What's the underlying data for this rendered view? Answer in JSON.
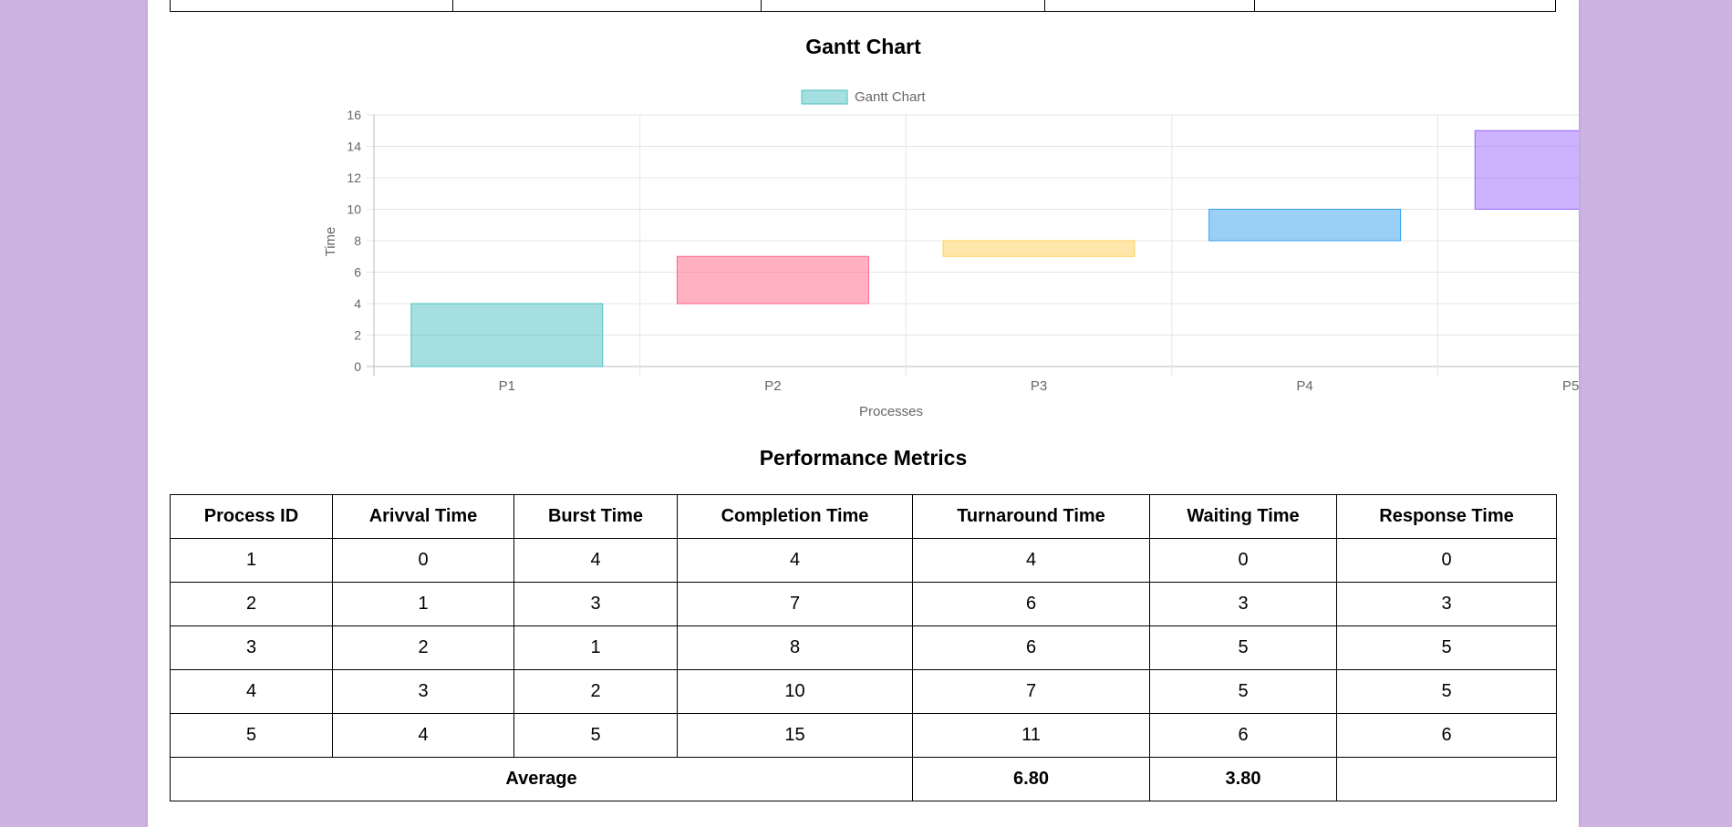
{
  "gantt": {
    "title": "Gantt Chart",
    "chart_data": {
      "type": "bar",
      "title": "",
      "legend": {
        "label": "Gantt Chart",
        "position": "top"
      },
      "xlabel": "Processes",
      "ylabel": "Time",
      "categories": [
        "P1",
        "P2",
        "P3",
        "P4",
        "P5"
      ],
      "ranges": [
        [
          0,
          4
        ],
        [
          4,
          7
        ],
        [
          7,
          8
        ],
        [
          8,
          10
        ],
        [
          10,
          15
        ]
      ],
      "ylim": [
        0,
        16
      ],
      "yticks": [
        0,
        2,
        4,
        6,
        8,
        10,
        12,
        14,
        16
      ],
      "grid": true,
      "colors": [
        "#4bc0c0",
        "#ff6384",
        "#ffce56",
        "#36a2eb",
        "#9966ff"
      ]
    }
  },
  "metrics": {
    "title": "Performance Metrics",
    "headers": [
      "Process ID",
      "Arivval Time",
      "Burst Time",
      "Completion Time",
      "Turnaround Time",
      "Waiting Time",
      "Response Time"
    ],
    "rows": [
      [
        "1",
        "0",
        "4",
        "4",
        "4",
        "0",
        "0"
      ],
      [
        "2",
        "1",
        "3",
        "7",
        "6",
        "3",
        "3"
      ],
      [
        "3",
        "2",
        "1",
        "8",
        "6",
        "5",
        "5"
      ],
      [
        "4",
        "3",
        "2",
        "10",
        "7",
        "5",
        "5"
      ],
      [
        "5",
        "4",
        "5",
        "15",
        "11",
        "6",
        "6"
      ]
    ],
    "average": {
      "label": "Average",
      "turnaround": "6.80",
      "waiting": "3.80",
      "response": ""
    }
  }
}
